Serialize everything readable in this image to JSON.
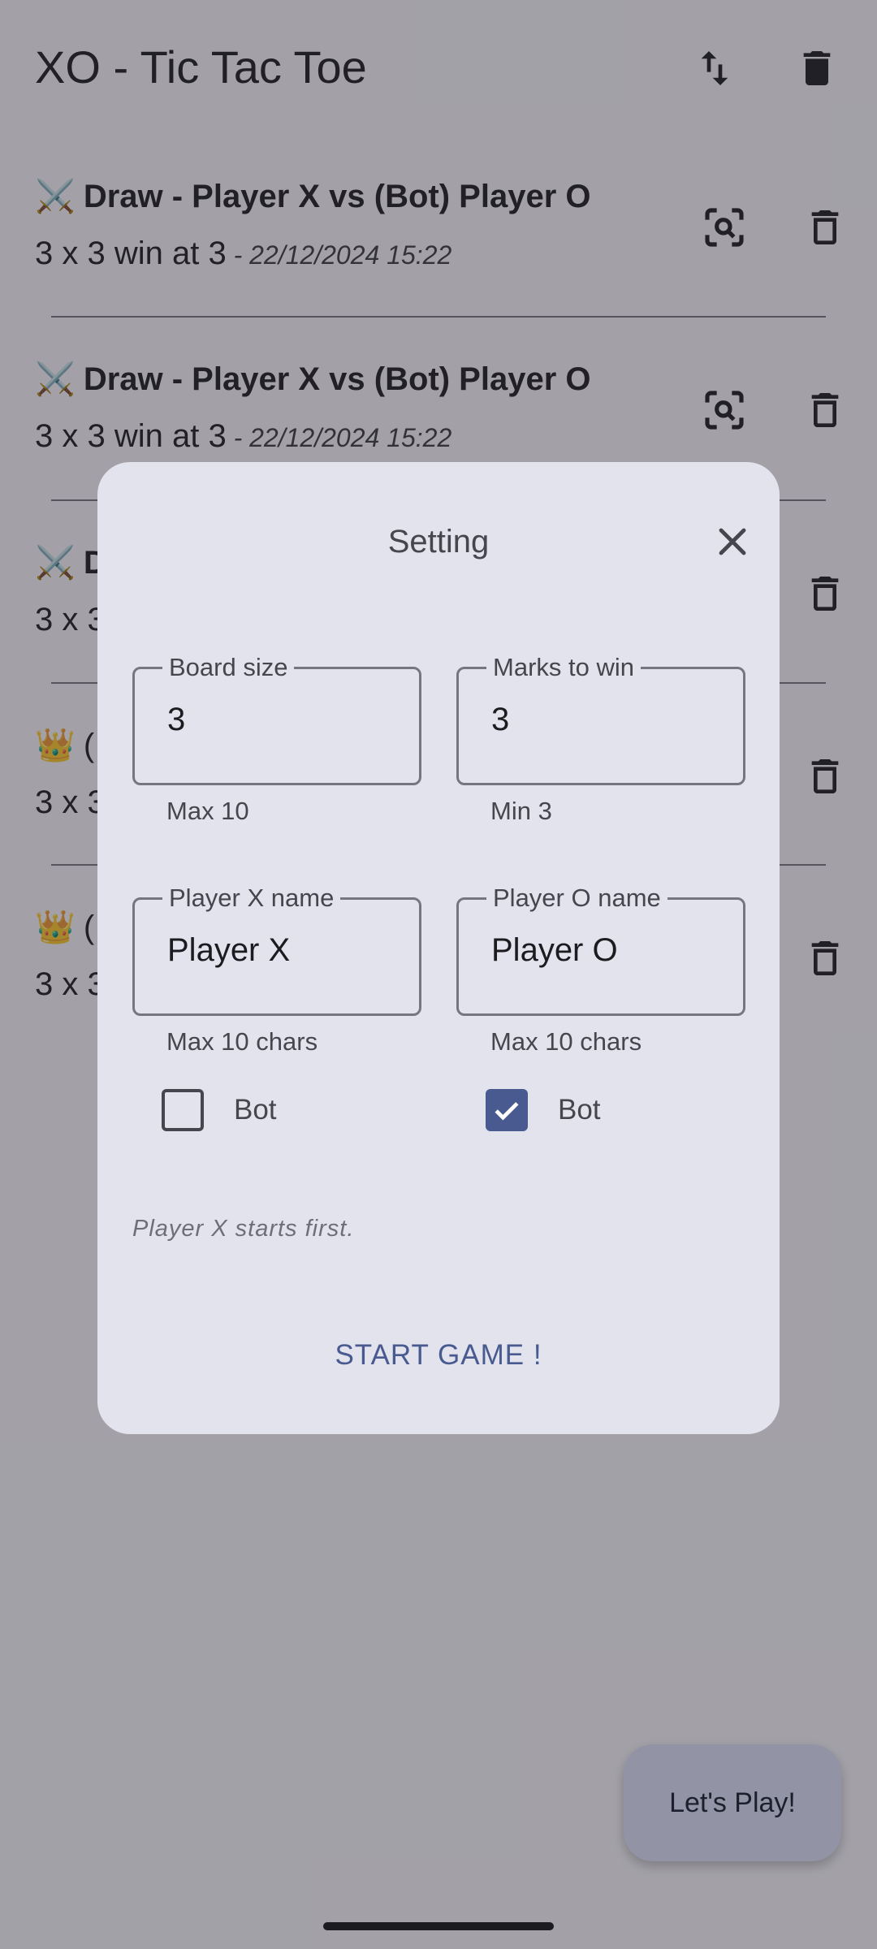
{
  "app": {
    "title": "XO - Tic Tac Toe"
  },
  "history": [
    {
      "icon": "⚔️",
      "result": "Draw - Player X vs (Bot) Player O",
      "config": "3 x 3 win at 3",
      "date": " - 22/12/2024 15:22"
    },
    {
      "icon": "⚔️",
      "result": "Draw - Player X vs (Bot) Player O",
      "config": "3 x 3 win at 3",
      "date": " - 22/12/2024 15:22"
    },
    {
      "icon": "⚔️",
      "result": "D",
      "config": "3 x 3",
      "date": ""
    },
    {
      "icon": "👑",
      "result": "(",
      "config": "3 x 3",
      "date": ""
    },
    {
      "icon": "👑",
      "result": "(",
      "config": "3 x 3",
      "date": ""
    }
  ],
  "fab": {
    "label": "Let's Play!"
  },
  "dialog": {
    "title": "Setting",
    "board_size": {
      "label": "Board size",
      "value": "3",
      "helper": "Max 10"
    },
    "marks_to_win": {
      "label": "Marks to win",
      "value": "3",
      "helper": "Min 3"
    },
    "player_x": {
      "label": "Player X name",
      "value": "Player X",
      "helper": "Max 10 chars",
      "bot_label": "Bot",
      "bot": false
    },
    "player_o": {
      "label": "Player O name",
      "value": "Player O",
      "helper": "Max 10 chars",
      "bot_label": "Bot",
      "bot": true
    },
    "note": "Player X starts first.",
    "start_label": "START GAME !"
  },
  "colors": {
    "accent": "#485a8f",
    "dialog_bg": "#e3e3ee",
    "fab_bg": "#dfe1f8",
    "scrim": "rgba(40,40,48,0.42)"
  },
  "icons": [
    "swap-vert-icon",
    "delete-icon",
    "search-zoom-icon",
    "close-icon",
    "check-icon"
  ]
}
